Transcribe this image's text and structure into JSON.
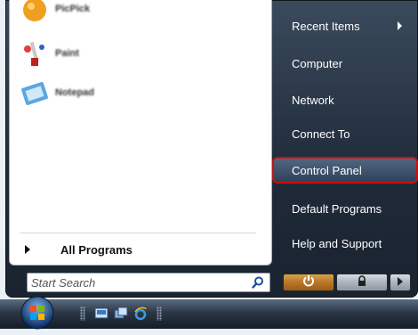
{
  "left_pane": {
    "programs": [
      {
        "label": "PicPick",
        "icon": "picpick-icon"
      },
      {
        "label": "Paint",
        "icon": "paint-icon"
      },
      {
        "label": "Notepad",
        "icon": "notepad-icon"
      }
    ],
    "all_programs_label": "All Programs"
  },
  "search": {
    "placeholder": "Start Search",
    "icon": "search-icon"
  },
  "right_pane": {
    "items": [
      {
        "label": "Recent Items",
        "has_submenu": true
      },
      {
        "label": "Computer"
      },
      {
        "label": "Network"
      },
      {
        "label": "Connect To"
      },
      {
        "label": "Control Panel",
        "highlighted": true
      },
      {
        "label": "Default Programs"
      },
      {
        "label": "Help and Support"
      }
    ]
  },
  "power_buttons": {
    "power_icon": "power-icon",
    "lock_icon": "lock-icon",
    "more_icon": "arrow-right-icon"
  },
  "taskbar": {
    "start_icon": "windows-orb-icon",
    "quick_launch": [
      "show-desktop-icon",
      "switch-windows-icon",
      "internet-explorer-icon"
    ]
  },
  "colors": {
    "highlight_border": "#cc1010",
    "menu_dark": "#1f2a38",
    "power_button": "#b7762a"
  }
}
